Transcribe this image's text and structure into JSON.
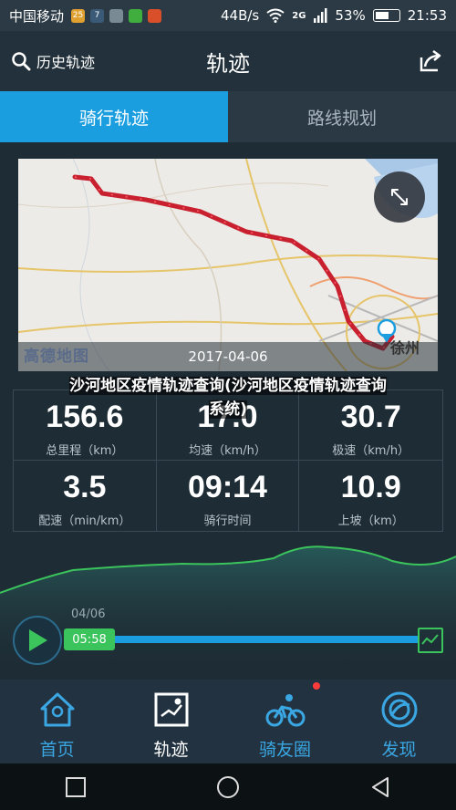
{
  "status_bar": {
    "carrier": "中国移动",
    "net_speed": "44B/s",
    "network": "2G",
    "battery": "53%",
    "time": "21:53"
  },
  "header": {
    "history_label": "历史轨迹",
    "title": "轨迹"
  },
  "tabs": [
    {
      "label": "骑行轨迹",
      "active": true
    },
    {
      "label": "路线规划",
      "active": false
    }
  ],
  "map": {
    "date": "2017-04-06",
    "logo": "高德地图",
    "city": "徐州"
  },
  "stats": [
    {
      "value": "156.6",
      "label": "总里程（km）"
    },
    {
      "value": "17.0",
      "label": "均速（km/h）"
    },
    {
      "value": "30.7",
      "label": "极速（km/h）"
    },
    {
      "value": "3.5",
      "label": "配速（min/km）"
    },
    {
      "value": "09:14",
      "label": "骑行时间"
    },
    {
      "value": "10.9",
      "label": "上坡（km）"
    }
  ],
  "overlay_caption": "沙河地区疫情轨迹查询(沙河地区疫情轨迹查询系统)",
  "playback": {
    "date": "04/06",
    "time": "05:58"
  },
  "bottom_nav": [
    {
      "label": "首页",
      "icon": "home-icon",
      "active": false
    },
    {
      "label": "轨迹",
      "icon": "track-icon",
      "active": true
    },
    {
      "label": "骑友圈",
      "icon": "cyclist-icon",
      "active": false
    },
    {
      "label": "发现",
      "icon": "discover-icon",
      "active": false
    }
  ],
  "colors": {
    "accent": "#1a9ee0",
    "route": "#d8283a",
    "progress_green": "#3bc35c",
    "background": "#1e2c35"
  }
}
